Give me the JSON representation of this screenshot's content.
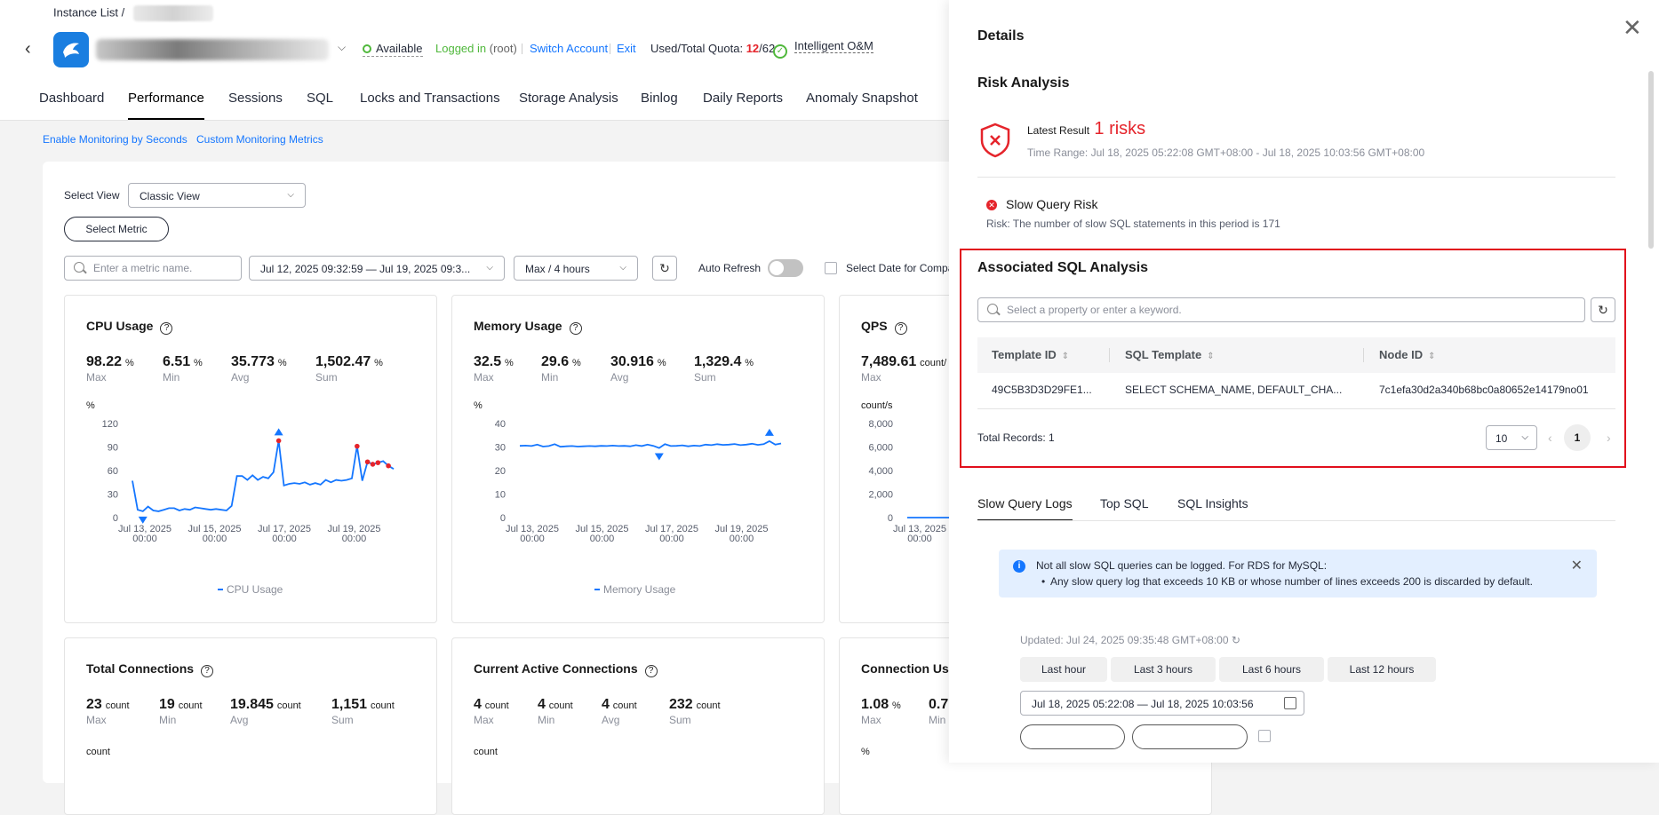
{
  "breadcrumb": {
    "root": "Instance List",
    "sep": "/"
  },
  "header": {
    "status": "Available",
    "logged_in": "Logged in",
    "logged_user": "(root)",
    "switch_account": "Switch Account",
    "exit": "Exit",
    "quota_label": "Used/Total Quota:",
    "quota_used": "12",
    "quota_total": "/62",
    "intelligent_om": "Intelligent O&M"
  },
  "tabs": [
    "Dashboard",
    "Performance",
    "Sessions",
    "SQL",
    "Locks and Transactions",
    "Storage Analysis",
    "Binlog",
    "Daily Reports",
    "Anomaly Snapshot"
  ],
  "sublinks": {
    "monitoring_seconds": "Enable Monitoring by Seconds",
    "custom_metrics": "Custom Monitoring Metrics"
  },
  "toolbar": {
    "select_view_label": "Select View",
    "select_view_value": "Classic View",
    "select_metric": "Select Metric",
    "metric_search_placeholder": "Enter a metric name.",
    "date_range": "Jul 12, 2025 09:32:59 — Jul 19, 2025 09:3...",
    "aggregation": "Max / 4 hours",
    "auto_refresh": "Auto Refresh",
    "compare_label": "Select Date for Compa"
  },
  "cards": {
    "cpu": {
      "title": "CPU Usage",
      "metrics": [
        {
          "v": "98.22",
          "u": "%",
          "k": "Max"
        },
        {
          "v": "6.51",
          "u": "%",
          "k": "Min"
        },
        {
          "v": "35.773",
          "u": "%",
          "k": "Avg"
        },
        {
          "v": "1,502.47",
          "u": "%",
          "k": "Sum"
        }
      ],
      "unit": "%",
      "legend": "CPU Usage"
    },
    "memory": {
      "title": "Memory Usage",
      "metrics": [
        {
          "v": "32.5",
          "u": "%",
          "k": "Max"
        },
        {
          "v": "29.6",
          "u": "%",
          "k": "Min"
        },
        {
          "v": "30.916",
          "u": "%",
          "k": "Avg"
        },
        {
          "v": "1,329.4",
          "u": "%",
          "k": "Sum"
        }
      ],
      "unit": "%",
      "legend": "Memory Usage"
    },
    "qps": {
      "title": "QPS",
      "metrics": [
        {
          "v": "7,489.61",
          "u": "count/",
          "k": "Max"
        }
      ],
      "unit": "count/s"
    },
    "total_conn": {
      "title": "Total Connections",
      "metrics": [
        {
          "v": "23",
          "u": "count",
          "k": "Max"
        },
        {
          "v": "19",
          "u": "count",
          "k": "Min"
        },
        {
          "v": "19.845",
          "u": "count",
          "k": "Avg"
        },
        {
          "v": "1,151",
          "u": "count",
          "k": "Sum"
        }
      ],
      "unit": "count"
    },
    "active_conn": {
      "title": "Current Active Connections",
      "metrics": [
        {
          "v": "4",
          "u": "count",
          "k": "Max"
        },
        {
          "v": "4",
          "u": "count",
          "k": "Min"
        },
        {
          "v": "4",
          "u": "count",
          "k": "Avg"
        },
        {
          "v": "232",
          "u": "count",
          "k": "Sum"
        }
      ],
      "unit": "count"
    },
    "conn_usage": {
      "title": "Connection Us",
      "metrics": [
        {
          "v": "1.08",
          "u": "%",
          "k": "Max"
        },
        {
          "v": "0.7",
          "u": "",
          "k": "Min"
        }
      ],
      "unit": "%"
    }
  },
  "chart_data": [
    {
      "type": "line",
      "title": "CPU Usage",
      "ylabel": "%",
      "ylim": [
        0,
        120
      ],
      "yticks": [
        "120",
        "90",
        "60",
        "30",
        "0"
      ],
      "xticks": [
        [
          "Jul 13, 2025",
          "00:00"
        ],
        [
          "Jul 15, 2025",
          "00:00"
        ],
        [
          "Jul 17, 2025",
          "00:00"
        ],
        [
          "Jul 19, 2025",
          "00:00"
        ]
      ],
      "series": [
        {
          "name": "CPU Usage",
          "color": "#1476ff",
          "values": [
            47,
            10,
            8,
            14,
            9,
            8,
            10,
            12,
            12,
            9,
            11,
            10,
            13,
            12,
            11,
            10,
            11,
            10,
            9,
            15,
            53,
            53,
            48,
            54,
            48,
            52,
            50,
            58,
            98,
            41,
            43,
            44,
            43,
            45,
            42,
            44,
            42,
            48,
            45,
            48,
            47,
            48,
            50,
            91,
            47,
            71,
            68,
            70,
            72,
            66,
            62
          ]
        }
      ],
      "markers": {
        "max_index": 28,
        "min_index": 2
      }
    },
    {
      "type": "line",
      "title": "Memory Usage",
      "ylabel": "%",
      "ylim": [
        0,
        40
      ],
      "yticks": [
        "40",
        "30",
        "20",
        "10",
        "0"
      ],
      "xticks": [
        [
          "Jul 13, 2025",
          "00:00"
        ],
        [
          "Jul 15, 2025",
          "00:00"
        ],
        [
          "Jul 17, 2025",
          "00:00"
        ],
        [
          "Jul 19, 2025",
          "00:00"
        ]
      ],
      "series": [
        {
          "name": "Memory Usage",
          "color": "#1476ff",
          "values": [
            30.5,
            30.6,
            30.4,
            31.0,
            30.2,
            30.4,
            31.2,
            30.1,
            30.3,
            30.4,
            30.2,
            30.3,
            30.4,
            30.3,
            30.5,
            30.4,
            30.6,
            30.4,
            30.5,
            30.3,
            30.8,
            30.4,
            31.0,
            30.5,
            29.6,
            31.2,
            30.4,
            30.5,
            30.7,
            30.3,
            30.6,
            30.4,
            31.0,
            30.8,
            31.2,
            30.9,
            31.0,
            31.3,
            30.8,
            31.0,
            31.4,
            30.9,
            31.2,
            32.5,
            31.0,
            31.5
          ]
        }
      ],
      "markers": {
        "max_index": 43,
        "min_index": 24
      }
    },
    {
      "type": "line",
      "title": "QPS",
      "ylabel": "count/s",
      "ylim": [
        0,
        8000
      ],
      "yticks": [
        "8,000",
        "6,000",
        "4,000",
        "2,000",
        "0"
      ],
      "xticks": [
        [
          "Jul 13, 2025",
          "00:00"
        ]
      ],
      "series": [
        {
          "name": "QPS",
          "color": "#1476ff",
          "values": [
            0,
            0,
            0,
            0,
            0,
            0
          ]
        }
      ]
    }
  ],
  "details": {
    "title": "Details",
    "risk_analysis": "Risk Analysis",
    "latest_result": "Latest Result",
    "risks": "1 risks",
    "time_range": "Time Range: Jul 18, 2025 05:22:08 GMT+08:00 - Jul 18, 2025 10:03:56 GMT+08:00",
    "slow_query_risk": "Slow Query Risk",
    "risk_desc": "Risk: The number of slow SQL statements in this period is 171",
    "assoc_title": "Associated SQL Analysis",
    "assoc_search_placeholder": "Select a property or enter a keyword.",
    "columns": [
      "Template ID",
      "SQL Template",
      "Node ID"
    ],
    "rows": [
      [
        "49C5B3D3D29FE1...",
        "SELECT SCHEMA_NAME, DEFAULT_CHA...",
        "7c1efa30d2a340b68bc0a80652e14179no01"
      ]
    ],
    "total_records": "Total Records: 1",
    "page_size": "10",
    "current_page": "1",
    "log_tabs": [
      "Slow Query Logs",
      "Top SQL",
      "SQL Insights"
    ],
    "note_line1": "Not all slow SQL queries can be logged. For RDS for MySQL:",
    "note_line2": "Any slow query log that exceeds 10 KB or whose number of lines exceeds 200 is discarded by default.",
    "updated": "Updated: Jul 24, 2025 09:35:48 GMT+08:00",
    "range_buttons": [
      "Last hour",
      "Last 3 hours",
      "Last 6 hours",
      "Last 12 hours"
    ],
    "date_range": "Jul 18, 2025 05:22:08 — Jul 18, 2025 10:03:56"
  }
}
